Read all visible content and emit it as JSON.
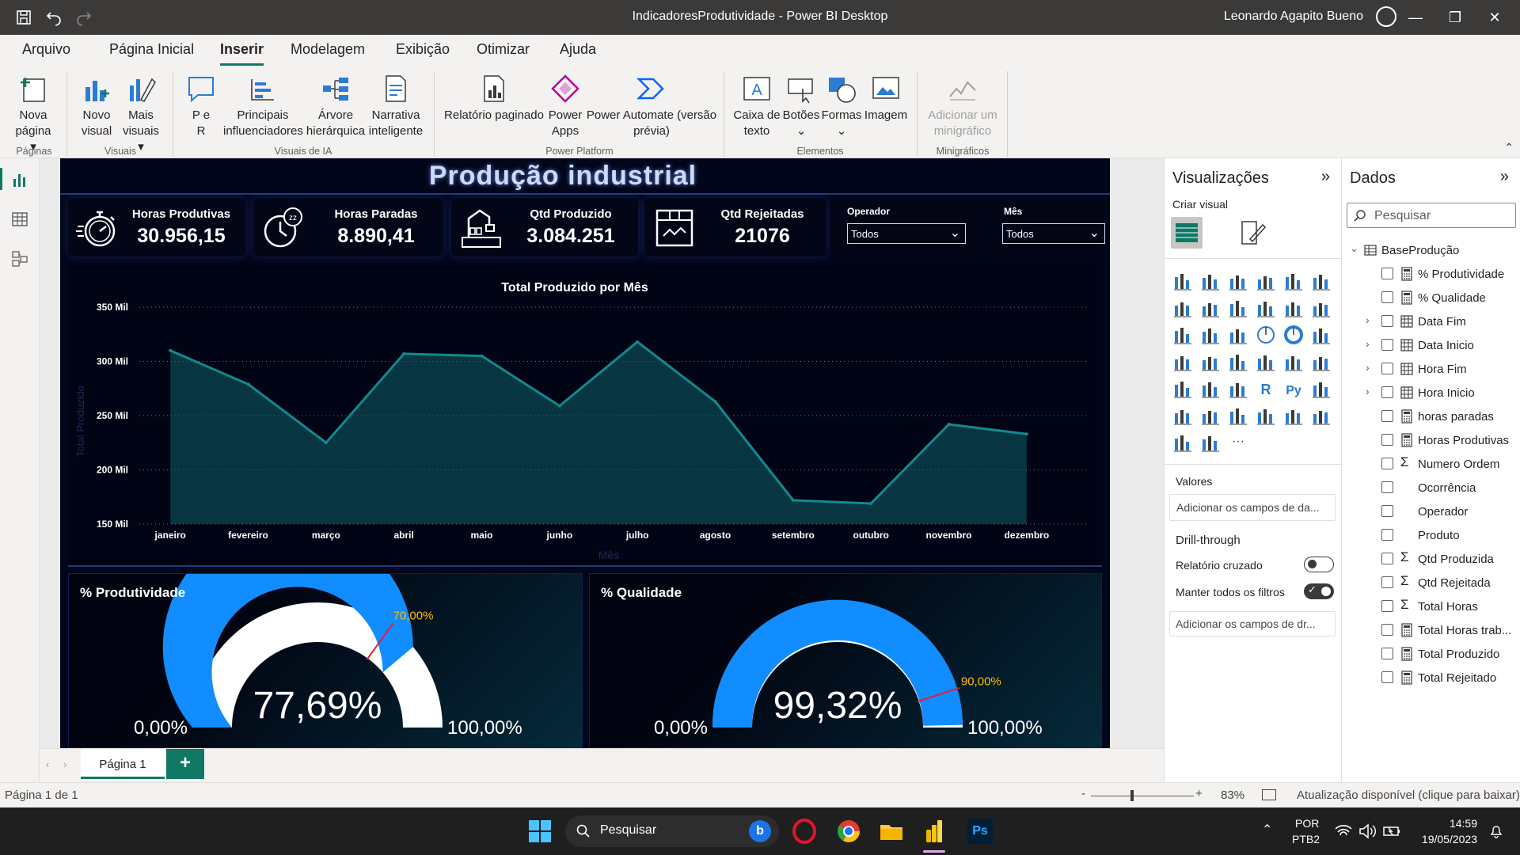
{
  "window": {
    "title": "IndicadoresProdutividade - Power BI Desktop",
    "user": "Leonardo Agapito Bueno"
  },
  "tabs": [
    "Arquivo",
    "Página Inicial",
    "Inserir",
    "Modelagem",
    "Exibição",
    "Otimizar",
    "Ajuda"
  ],
  "active_tab": "Inserir",
  "ribbon": {
    "nova_pagina": "Nova\npágina ▾",
    "novo_visual": "Novo\nvisual",
    "mais_visuais": "Mais\nvisuais ▾",
    "pe_r": "P e\nR",
    "principais": "Principais\ninfluenciadores",
    "arvore": "Árvore\nhierárquica",
    "narrativa": "Narrativa\ninteligente",
    "relatorio": "Relatório paginado",
    "power_apps": "Power\nApps",
    "power_automate": "Power Automate (versão\nprévia)",
    "caixa_texto": "Caixa de\ntexto",
    "botoes": "Botões\n⌄",
    "formas": "Formas\n⌄",
    "imagem": "Imagem",
    "minigrafico": "Adicionar um\nminigráfico",
    "groups": {
      "paginas": "Páginas",
      "visuais": "Visuais",
      "visuais_ia": "Visuais de IA",
      "power_platform": "Power Platform",
      "elementos": "Elementos",
      "minigraficos": "Minigráficos"
    }
  },
  "report": {
    "title": "Produção industrial",
    "kpis": [
      {
        "label": "Horas Produtivas",
        "value": "30.956,15",
        "icon": "stopwatch-icon"
      },
      {
        "label": "Horas Paradas",
        "value": "8.890,41",
        "icon": "clock-sleep-icon"
      },
      {
        "label": "Qtd Produzido",
        "value": "3.084.251",
        "icon": "factory-robot-icon"
      },
      {
        "label": "Qtd Rejeitadas",
        "value": "21076",
        "icon": "box-icon"
      }
    ],
    "slicers": [
      {
        "label": "Operador",
        "value": "Todos"
      },
      {
        "label": "Mês",
        "value": "Todos"
      }
    ],
    "gauges": [
      {
        "title": "% Produtividade",
        "value": 0.7769,
        "value_label": "77,69%",
        "target": 0.7,
        "target_label": "70,00%",
        "min_label": "0,00%",
        "max_label": "100,00%"
      },
      {
        "title": "% Qualidade",
        "value": 0.9932,
        "value_label": "99,32%",
        "target": 0.9,
        "target_label": "90,00%",
        "min_label": "0,00%",
        "max_label": "100,00%"
      }
    ]
  },
  "chart_data": {
    "type": "area",
    "title": "Total Produzido por Mês",
    "xlabel": "Mês",
    "ylabel": "Total Produzido",
    "categories": [
      "janeiro",
      "fevereiro",
      "março",
      "abril",
      "maio",
      "junho",
      "julho",
      "agosto",
      "setembro",
      "outubro",
      "novembro",
      "dezembro"
    ],
    "values": [
      310,
      279,
      225,
      307,
      305,
      259,
      318,
      263,
      172,
      169,
      242,
      233
    ],
    "value_unit": "Mil",
    "ylim": [
      150,
      350
    ],
    "yticks": [
      "150 Mil",
      "200 Mil",
      "250 Mil",
      "300 Mil",
      "350 Mil"
    ],
    "grid": true,
    "color": "#0d5e66"
  },
  "visualizations": {
    "title": "Visualizações",
    "subtitle": "Criar visual",
    "valores": "Valores",
    "valores_placeholder": "Adicionar os campos de da...",
    "drillthrough": "Drill-through",
    "relatorio_cruzado": "Relatório cruzado",
    "manter_filtros": "Manter todos os filtros",
    "drill_placeholder": "Adicionar os campos de dr..."
  },
  "dados": {
    "title": "Dados",
    "search_placeholder": "Pesquisar",
    "table": "BaseProdução",
    "fields": [
      {
        "name": "% Produtividade",
        "icon": "calc",
        "expand": false
      },
      {
        "name": "% Qualidade",
        "icon": "calc",
        "expand": false
      },
      {
        "name": "Data Fim",
        "icon": "calendar",
        "expand": true
      },
      {
        "name": "Data Inicio",
        "icon": "calendar",
        "expand": true
      },
      {
        "name": "Hora Fim",
        "icon": "calendar",
        "expand": true
      },
      {
        "name": "Hora Inicio",
        "icon": "calendar",
        "expand": true
      },
      {
        "name": "horas paradas",
        "icon": "calc",
        "expand": false
      },
      {
        "name": "Horas Produtivas",
        "icon": "calc",
        "expand": false
      },
      {
        "name": "Numero Ordem",
        "icon": "sigma",
        "expand": false
      },
      {
        "name": "Ocorrência",
        "icon": "none",
        "expand": false
      },
      {
        "name": "Operador",
        "icon": "none",
        "expand": false
      },
      {
        "name": "Produto",
        "icon": "none",
        "expand": false
      },
      {
        "name": "Qtd Produzida",
        "icon": "sigma",
        "expand": false
      },
      {
        "name": "Qtd Rejeitada",
        "icon": "sigma",
        "expand": false
      },
      {
        "name": "Total Horas",
        "icon": "sigma",
        "expand": false
      },
      {
        "name": "Total Horas trab...",
        "icon": "calc",
        "expand": false
      },
      {
        "name": "Total Produzido",
        "icon": "calc",
        "expand": false
      },
      {
        "name": "Total Rejeitado",
        "icon": "calc",
        "expand": false
      }
    ]
  },
  "pages": {
    "tab": "Página 1",
    "add": "+"
  },
  "status": {
    "page": "Página 1 de 1",
    "zoom": "83%",
    "update": "Atualização disponível (clique para baixar)",
    "zoom_minus": "-",
    "zoom_plus": "+"
  },
  "taskbar": {
    "search": "Pesquisar",
    "lang1": "POR",
    "lang2": "PTB2",
    "time": "14:59",
    "date": "19/05/2023"
  }
}
